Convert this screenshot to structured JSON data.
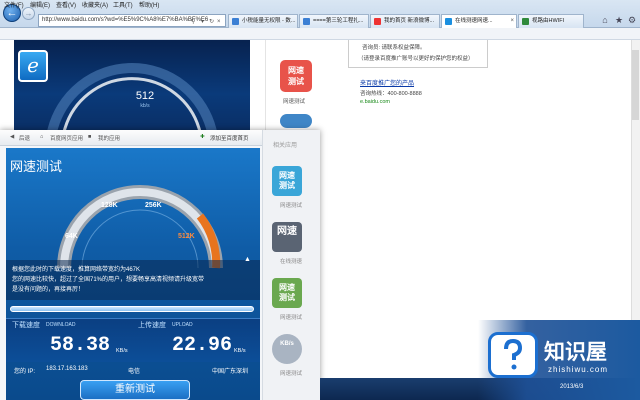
{
  "browser": {
    "address": "http://www.baidu.com/s?wd=%E5%9C%A8%E7%BA%BF%E6",
    "tabs": [
      {
        "label": "小税能量无权限 - 数..."
      },
      {
        "label": "====第三轮工程扎..."
      },
      {
        "label": "我的首页 新浪微博..."
      },
      {
        "label": "在线测速网速..."
      },
      {
        "label": "视路由HWIFI"
      }
    ],
    "menu": [
      "文件(F)",
      "编辑(E)",
      "查看(V)",
      "收藏夹(A)",
      "工具(T)",
      "帮助(H)"
    ]
  },
  "left_page": {
    "big_speed_value": "512",
    "big_speed_unit": "kb/s",
    "apps": [
      {
        "icon_text": "网速\n测试",
        "label": "网速测试",
        "color": "#e8534a"
      }
    ]
  },
  "right_page": {
    "line1": "咨询员: 请联系权益保障。",
    "line2": "（请登录百度推广账号以更好的保护您的权益）",
    "promo_link": "来百度推广您的产品",
    "hotline": "咨询热线：400-800-8888",
    "site": "e.baidu.com"
  },
  "overlay": {
    "nav_back": "后退",
    "nav_home": "百度网页应用",
    "nav_mine": "我的应用",
    "nav_add": "添加至百度首页",
    "side_title": "相关应用",
    "title": "网速测试",
    "gauge_labels": [
      "64K",
      "128K",
      "256K",
      "512K"
    ],
    "result_line1": "根据您此时的下载速度，推算网络带宽约为467K",
    "result_line2": "您的网速比较快，超过了全国71%的用户，想要畅享高清视频请升级宽带",
    "result_line3": "是没有问题的，再接再厉！",
    "download_label": "下载速度",
    "download_en": "DOWNLOAD",
    "upload_label": "上传速度",
    "upload_en": "UPLOAD",
    "download_value": "58.38",
    "upload_value": "22.96",
    "unit": "KB/s",
    "ip_label": "您的 IP:",
    "ip_value": "183.17.163.183",
    "isp": "电信",
    "location": "中国广东深圳",
    "retest_button": "重新测试",
    "side_apps": [
      {
        "text": "网速\n测试",
        "label": "网速测试",
        "color": "#3aa6d8"
      },
      {
        "text": "网速",
        "label": "在线测速",
        "color": "#5a6473"
      },
      {
        "text": "网速\n测试",
        "label": "网速测试",
        "color": "#6aa84f"
      },
      {
        "text": "KB/s",
        "label": "网速测试",
        "color": "#a9b4c2"
      }
    ]
  },
  "taskbar": {
    "date": "2013/6/3"
  },
  "watermark": {
    "title": "知识屋",
    "url": "zhishiwu.com"
  }
}
